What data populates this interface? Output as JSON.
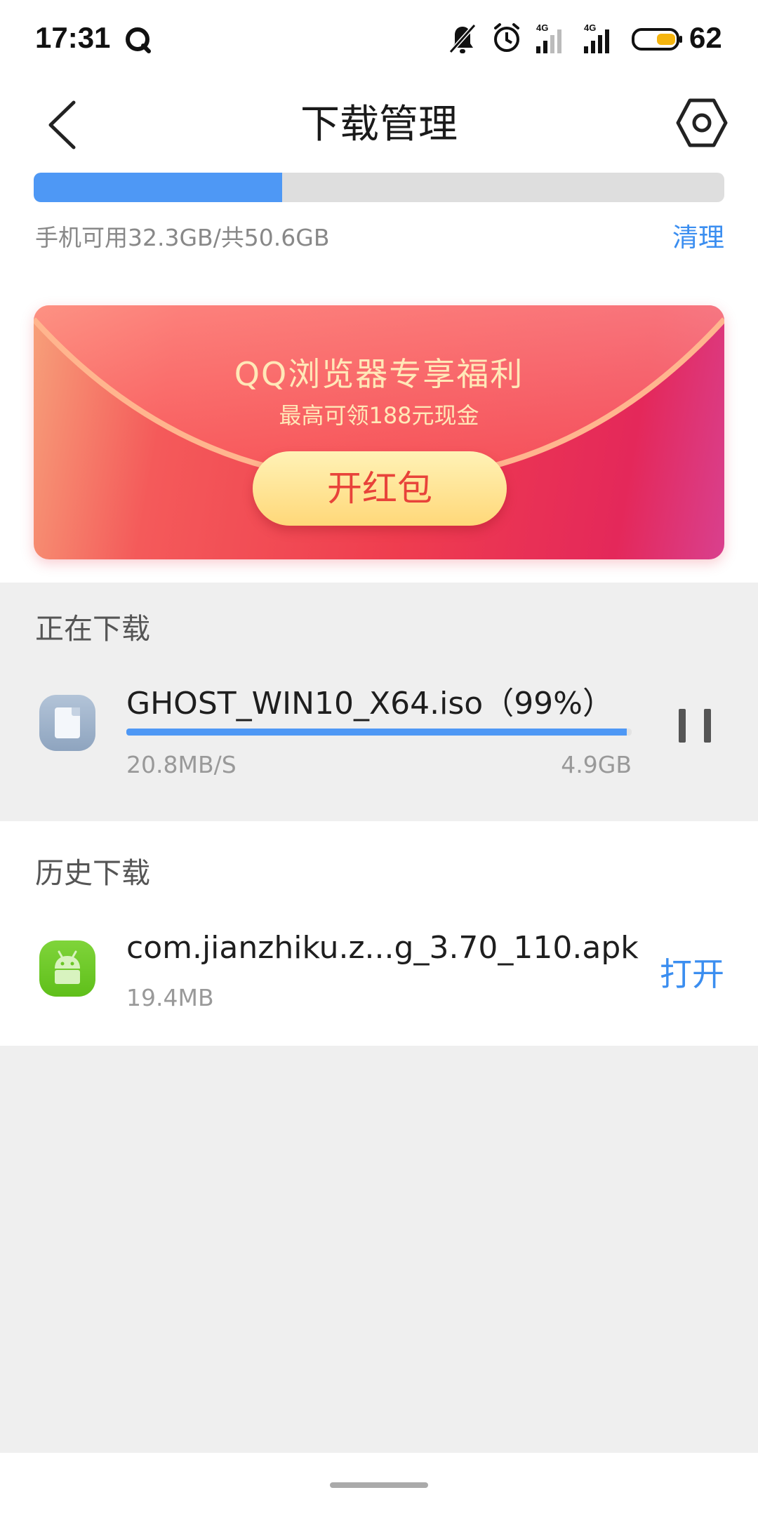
{
  "status_bar": {
    "time": "17:31",
    "battery_level": "62",
    "signal_1_label": "4G",
    "signal_2_label": "4G",
    "icons": [
      "q-icon",
      "bell-muted-icon",
      "alarm-icon",
      "signal-4g-icon",
      "signal-4g-icon",
      "battery-icon"
    ]
  },
  "header": {
    "title": "下载管理",
    "icons": [
      "back-arrow-icon",
      "settings-hexagon-icon"
    ]
  },
  "storage": {
    "text": "手机可用32.3GB/共50.6GB",
    "clean_label": "清理",
    "available_gb": 32.3,
    "total_gb": 50.6,
    "used_fraction": 0.36
  },
  "banner": {
    "title": "QQ浏览器专享福利",
    "subtitle": "最高可领188元现金",
    "button_label": "开红包"
  },
  "downloading": {
    "section_title": "正在下载",
    "items": [
      {
        "name": "GHOST_WIN10_X64.iso（99%）",
        "speed": "20.8MB/S",
        "size": "4.9GB",
        "progress": 0.99,
        "icon": "file-icon",
        "action_icon": "pause-icon"
      }
    ]
  },
  "history": {
    "section_title": "历史下载",
    "items": [
      {
        "name": "com.jianzhiku.z...g_3.70_110.apk",
        "size": "19.4MB",
        "action_label": "打开",
        "icon": "android-apk-icon"
      }
    ]
  },
  "colors": {
    "accent": "#3b8ef0",
    "progress": "#4e98f5",
    "banner_red": "#ef3d4f",
    "banner_button": "#ffd879"
  }
}
